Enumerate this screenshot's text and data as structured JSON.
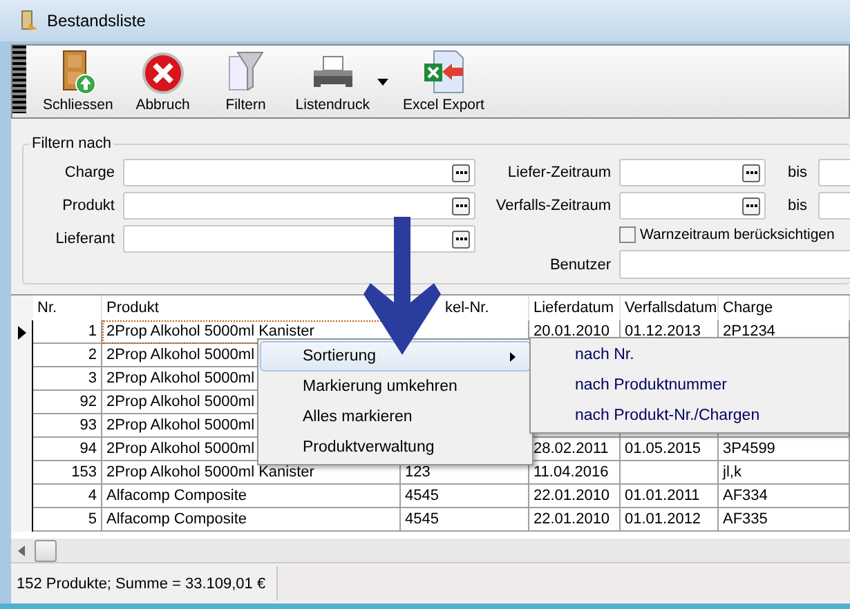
{
  "window": {
    "title": "Bestandsliste"
  },
  "toolbar": [
    {
      "kind": "door",
      "label": "Schliessen"
    },
    {
      "kind": "cancel",
      "label": "Abbruch"
    },
    {
      "kind": "funnel",
      "label": "Filtern"
    },
    {
      "kind": "printer",
      "label": "Listendruck",
      "dropdown": true
    },
    {
      "kind": "excel",
      "label": "Excel Export"
    }
  ],
  "filter": {
    "title": "Filtern nach",
    "left_fields": [
      {
        "label": "Charge"
      },
      {
        "label": "Produkt"
      },
      {
        "label": "Lieferant"
      }
    ],
    "ranges": [
      {
        "label": "Liefer-Zeitraum",
        "to_label": "bis"
      },
      {
        "label": "Verfalls-Zeitraum",
        "to_label": "bis"
      }
    ],
    "warn_checkbox": {
      "label": "Warnzeitraum berücksichtigen",
      "checked": false
    },
    "user_label": "Benutzer"
  },
  "table": {
    "columns": [
      "Nr.",
      "Produkt",
      "kel-Nr.",
      "Lieferdatum",
      "Verfallsdatum",
      "Charge"
    ],
    "rows": [
      {
        "current": true,
        "nr": "1",
        "produkt": "2Prop Alkohol 5000ml Kanister",
        "lieferdatum": "20.01.2010",
        "verfallsdatum": "01.12.2013",
        "charge": "2P1234"
      },
      {
        "current": false,
        "nr": "2",
        "produkt": "2Prop Alkohol 5000ml"
      },
      {
        "current": false,
        "nr": "3",
        "produkt": "2Prop Alkohol 5000ml"
      },
      {
        "current": false,
        "nr": "92",
        "produkt": "2Prop Alkohol 5000ml"
      },
      {
        "current": false,
        "nr": "93",
        "produkt": "2Prop Alkohol 5000ml"
      },
      {
        "current": false,
        "nr": "94",
        "produkt": "2Prop Alkohol 5000ml",
        "lieferdatum": "28.02.2011",
        "verfallsdatum": "01.05.2015",
        "charge": "3P4599"
      },
      {
        "current": false,
        "nr": "153",
        "produkt": "2Prop Alkohol 5000ml Kanister",
        "artikel": "123",
        "lieferdatum": "11.04.2016",
        "charge": "jl,k"
      },
      {
        "current": false,
        "nr": "4",
        "produkt": "Alfacomp Composite",
        "artikel": "4545",
        "lieferdatum": "22.01.2010",
        "verfallsdatum": "01.01.2011",
        "charge": "AF334"
      },
      {
        "current": false,
        "nr": "5",
        "produkt": "Alfacomp Composite",
        "artikel": "4545",
        "lieferdatum": "22.01.2010",
        "verfallsdatum": "01.01.2012",
        "charge": "AF335"
      }
    ]
  },
  "context_menu": {
    "items": [
      {
        "label": "Sortierung",
        "selected": true,
        "submenu": true
      },
      {
        "label": "Markierung umkehren",
        "selected": false,
        "submenu": false
      },
      {
        "label": "Alles markieren",
        "selected": false,
        "submenu": false
      },
      {
        "label": "Produktverwaltung",
        "selected": false,
        "submenu": false
      }
    ],
    "submenu": [
      {
        "label": "nach Nr."
      },
      {
        "label": "nach Produktnummer"
      },
      {
        "label": "nach Produkt-Nr./Chargen"
      }
    ]
  },
  "status_bar": {
    "text": "152 Produkte; Summe  = 33.109,01 €"
  }
}
